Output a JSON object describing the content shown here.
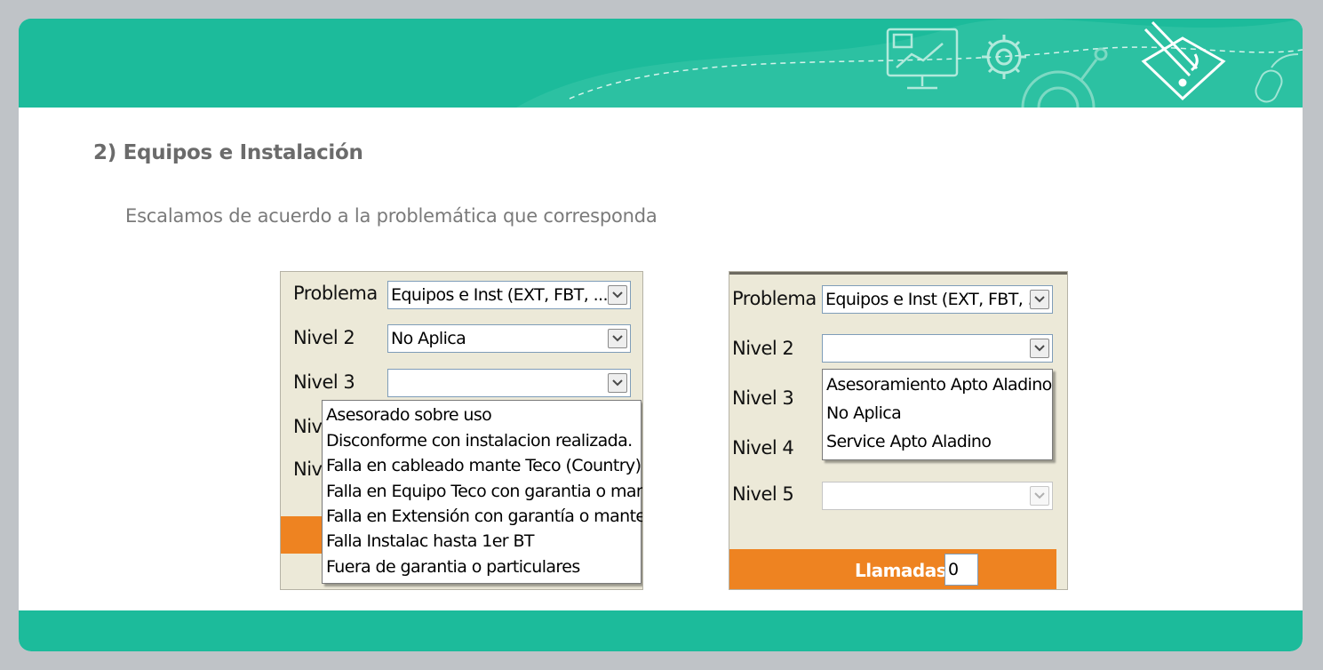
{
  "section_title": "2) Equipos e Instalación",
  "description": "Escalamos de acuerdo a la problemática que corresponda",
  "colors": {
    "header": "#1cbb9b",
    "accent_orange": "#ee8321",
    "panel_bg": "#ece9d8"
  },
  "left_form": {
    "problema_label": "Problema",
    "problema_value": "Equipos e Inst (EXT, FBT, ...",
    "nivel2_label": "Nivel 2",
    "nivel2_value": "No Aplica",
    "nivel3_label": "Nivel 3",
    "nivel3_value": "",
    "nivel4_label_partial": "Niv",
    "nivel5_label_partial": "Niv",
    "dropdown_options": [
      "Asesorado sobre uso",
      "Disconforme con instalacion realizada.",
      "Falla en cableado mante Teco (Country)",
      "Falla en Equipo Teco con garantia o mante",
      "Falla en Extensión con garantía o mante",
      "Falla Instalac hasta 1er BT",
      "Fuera de garantia o particulares"
    ]
  },
  "right_form": {
    "problema_label": "Problema",
    "problema_value": "Equipos e Inst (EXT, FBT, ...",
    "nivel2_label": "Nivel 2",
    "nivel2_value": "",
    "nivel3_label": "Nivel 3",
    "nivel4_label": "Nivel 4",
    "nivel5_label": "Nivel 5",
    "nivel5_value": "",
    "dropdown_options": [
      "Asesoramiento Apto Aladino",
      "No Aplica",
      "Service Apto Aladino"
    ],
    "llamadas_label": "Llamadas",
    "llamadas_value": "0"
  },
  "icons": [
    "monitor-chart-icon",
    "gear-icon",
    "large-gear-icon",
    "pencil-question-icon",
    "mouse-icon"
  ]
}
